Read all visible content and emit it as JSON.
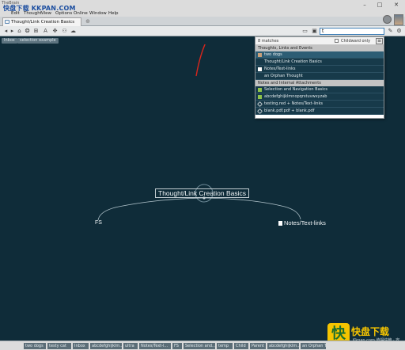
{
  "titlebar": {
    "app_badge": "TheBrain"
  },
  "menubar": {
    "watermark": "快盘下载 KKPAN.COM",
    "items": [
      "Edit",
      "Thought",
      "View",
      "Options",
      "Online",
      "Window",
      "Help"
    ]
  },
  "tabs": {
    "active_label": "Thought/Link Creation Basics"
  },
  "toolbar": {
    "search_value": "t"
  },
  "breadcrumb": [
    "Inbox",
    "selection example"
  ],
  "plex": {
    "central_thought": "Thought/Link Creation Basics",
    "children": [
      "FS",
      "Notes/Text-links"
    ]
  },
  "search_popup": {
    "match_count": "8 matches",
    "childward_only_label": "Childward only",
    "sections": [
      {
        "title": "Thoughts, Links and Events",
        "results": [
          {
            "label": "two dogs",
            "icon": "dog-image-icon",
            "selected": true
          },
          {
            "label": "Thought/Link Creation Basics",
            "icon": "none"
          },
          {
            "label": "Notes/Text-links",
            "icon": "note-icon"
          },
          {
            "label": "an Orphan Thought",
            "icon": "none"
          }
        ]
      },
      {
        "title": "Notes and Internal Attachments",
        "results": [
          {
            "label": "Selection and Navigation Basics",
            "icon": "green-note-icon"
          },
          {
            "label": "abcdefghijklmnopqrstuvwxyzab",
            "icon": "green-note-icon"
          },
          {
            "label": "testing.red + Notes/Text-links",
            "icon": "link-icon"
          },
          {
            "label": "blank.pdf.pdf + blank.pdf",
            "icon": "link-icon"
          }
        ]
      }
    ]
  },
  "pins": [
    "two dogs",
    "testy cat",
    "Inbox",
    "abcdefghijklm...",
    "ultra",
    "Notes/Text-l...",
    "FS",
    "Selection and...",
    "temp",
    "Child",
    "Parent",
    "abcdefghijklm...",
    "an Orphan T..."
  ],
  "branding": {
    "logo_char": "快",
    "name": "快盘下载",
    "sub": "Kkpan.com 值得信赖 · 安全 · 下载"
  },
  "colors": {
    "canvas": "#0f2c39",
    "accent": "#3f7fb6",
    "annotation_red": "#d9261c"
  }
}
